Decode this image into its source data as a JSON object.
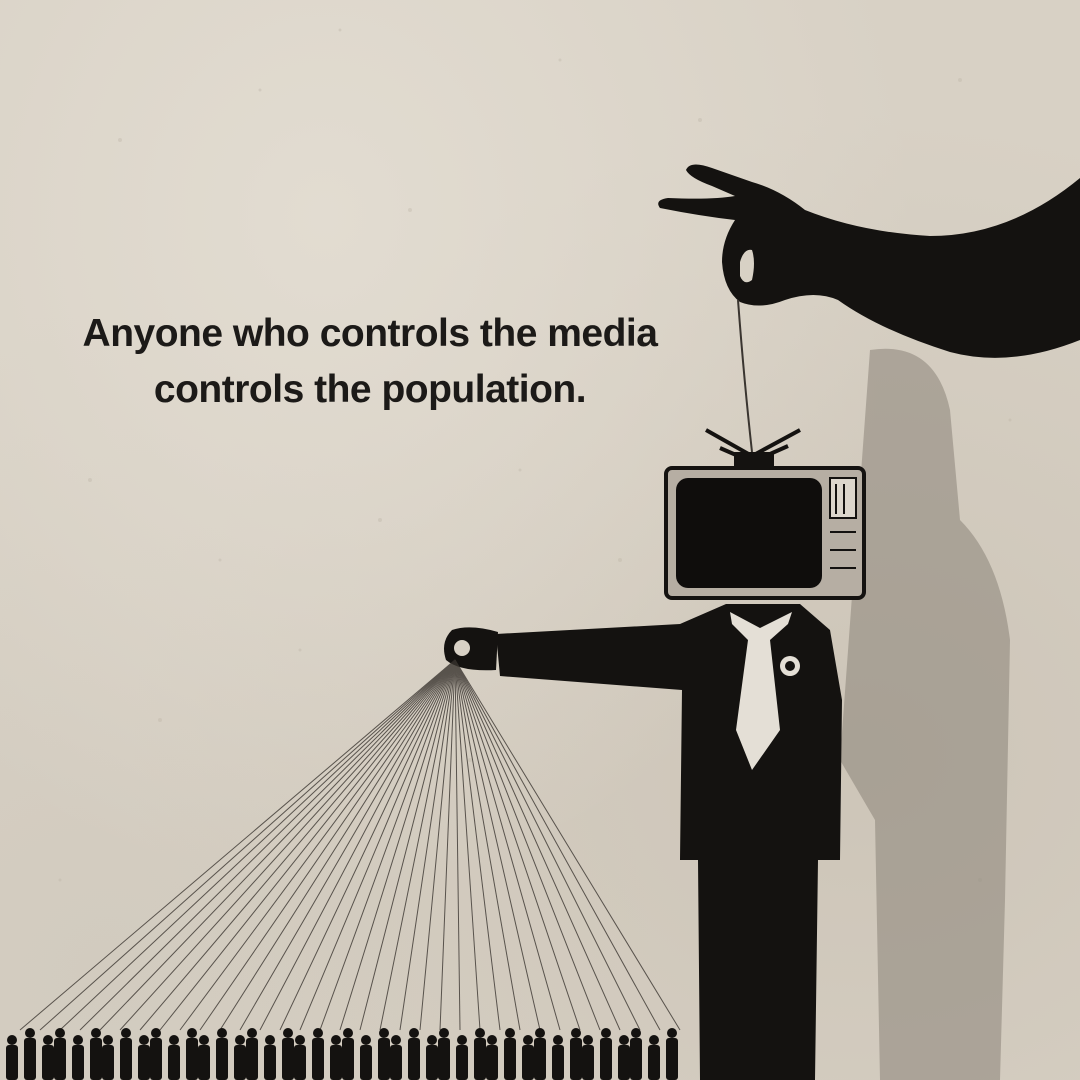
{
  "caption": {
    "line1": "Anyone who controls the media",
    "line2": "controls the population."
  },
  "colors": {
    "background": "#d8d1c5",
    "ink": "#141210",
    "shadow": "#8a8379",
    "string": "#3a3530"
  },
  "icons": [
    "puppeteer-hand",
    "tv-head-figure",
    "crowd-silhouettes",
    "puppet-strings"
  ]
}
